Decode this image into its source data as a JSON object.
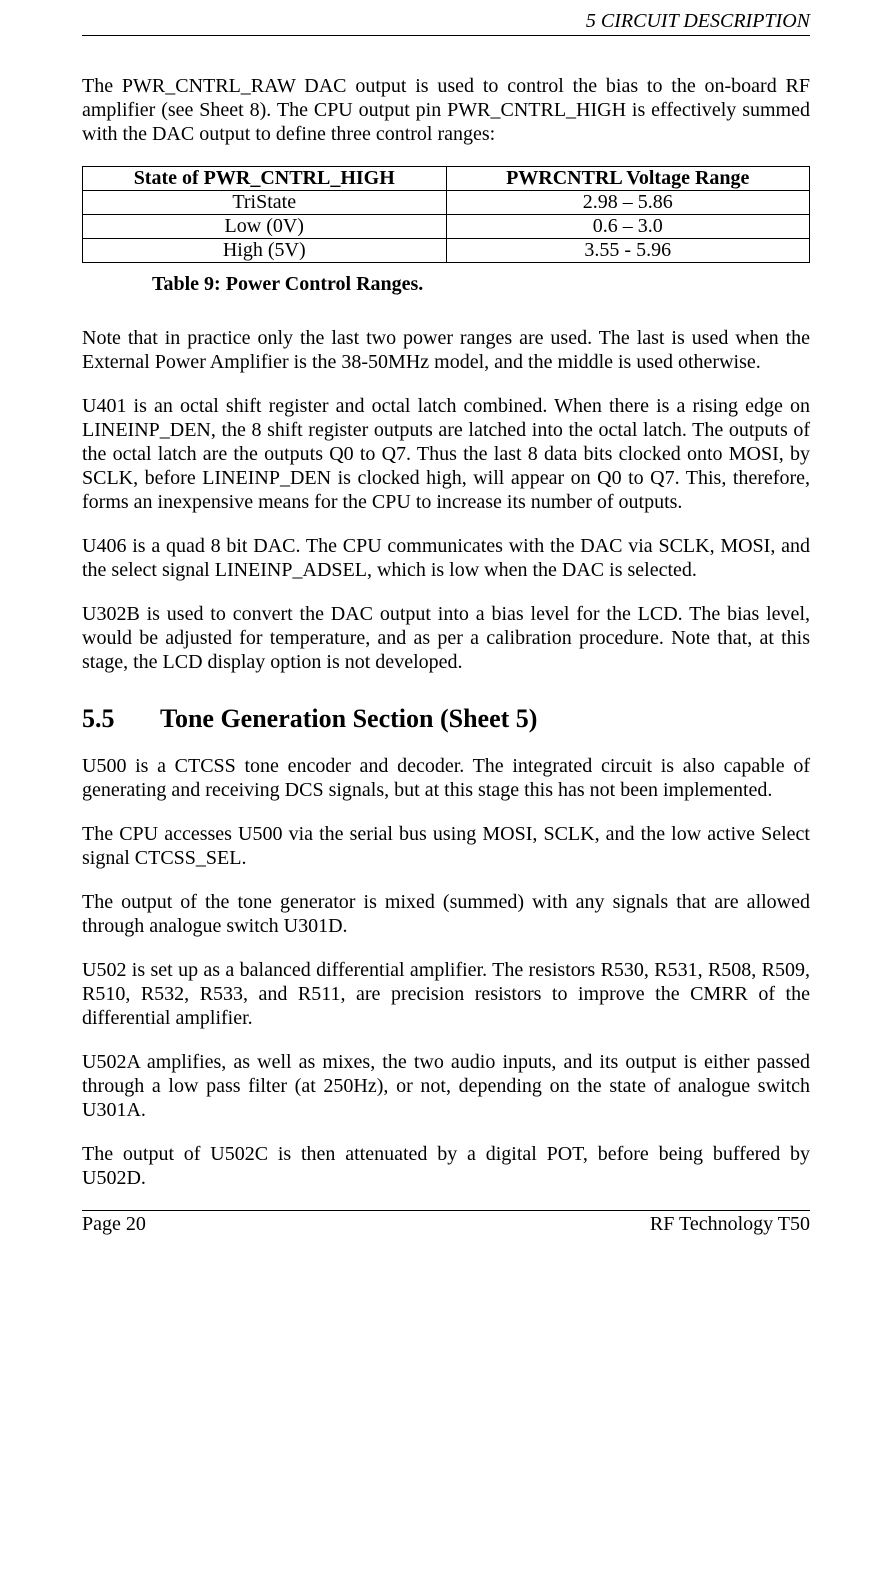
{
  "header": "5  CIRCUIT DESCRIPTION",
  "p1": "The PWR_CNTRL_RAW DAC output is used to control the bias to the on-board RF amplifier (see Sheet 8).  The CPU output pin PWR_CNTRL_HIGH is effectively summed with the DAC output to define three control ranges:",
  "table": {
    "h1": "State of PWR_CNTRL_HIGH",
    "h2": "PWRCNTRL Voltage Range",
    "rows": [
      {
        "c1": "TriState",
        "c2": "2.98 – 5.86"
      },
      {
        "c1": "Low (0V)",
        "c2": "0.6 – 3.0"
      },
      {
        "c1": "High (5V)",
        "c2": "3.55 - 5.96"
      }
    ]
  },
  "table_caption": "Table 9:  Power Control Ranges.",
  "p2": "Note that in practice only the last two power ranges are used. The last is used when the External Power Amplifier is the 38-50MHz model, and the middle is used otherwise.",
  "p3": "U401 is an octal shift register and octal latch combined.  When there is a rising edge on LINEINP_DEN, the 8 shift register outputs are latched into the octal latch.  The outputs of the octal latch are the outputs Q0 to Q7.  Thus the last 8 data bits clocked onto MOSI, by SCLK, before LINEINP_DEN is clocked high, will appear on Q0 to Q7.  This, therefore, forms an inexpensive means for the CPU to increase its number of outputs.",
  "p4": "U406 is a quad 8 bit DAC.  The CPU communicates with the DAC via SCLK, MOSI, and the select signal LINEINP_ADSEL, which is low when the DAC is selected.",
  "p5": "U302B is used to convert the DAC output into a bias level for the LCD.  The bias level, would be adjusted for temperature, and as per a calibration procedure.  Note that, at this stage, the LCD display option is not developed.",
  "section": {
    "num": "5.5",
    "title": "Tone Generation Section (Sheet 5)"
  },
  "p6": "U500 is a CTCSS tone encoder and decoder.  The integrated circuit is also capable of generating and receiving DCS signals, but at this stage this has not been implemented.",
  "p7": "The CPU accesses U500 via the serial bus using MOSI, SCLK, and the low active Select signal CTCSS_SEL.",
  "p8": "The output of the tone generator is mixed (summed) with any signals that are allowed through analogue switch U301D.",
  "p9": "U502 is set up as a balanced differential amplifier.  The resistors R530, R531, R508, R509, R510, R532, R533, and R511, are precision resistors to improve the CMRR of the differential amplifier.",
  "p10": "U502A amplifies, as well as mixes, the two audio inputs, and its output is either passed through a low pass filter (at 250Hz), or not, depending on the state of analogue switch U301A.",
  "p11": "The output of U502C is then attenuated by a digital POT, before being buffered by U502D.",
  "footer": {
    "left": "Page 20",
    "right": "RF Technology T50"
  }
}
